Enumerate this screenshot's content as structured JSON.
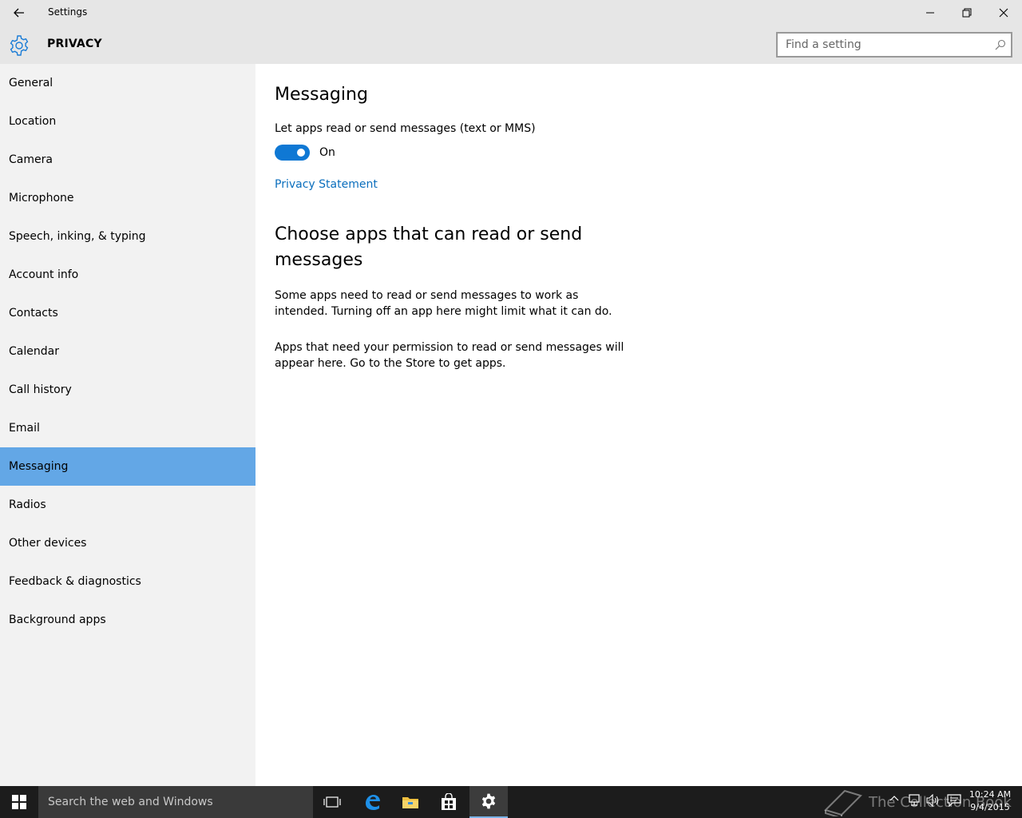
{
  "window": {
    "title": "Settings"
  },
  "header": {
    "section_title": "PRIVACY",
    "search_placeholder": "Find a setting"
  },
  "sidebar": {
    "items": [
      {
        "label": "General"
      },
      {
        "label": "Location"
      },
      {
        "label": "Camera"
      },
      {
        "label": "Microphone"
      },
      {
        "label": "Speech, inking, & typing"
      },
      {
        "label": "Account info"
      },
      {
        "label": "Contacts"
      },
      {
        "label": "Calendar"
      },
      {
        "label": "Call history"
      },
      {
        "label": "Email"
      },
      {
        "label": "Messaging"
      },
      {
        "label": "Radios"
      },
      {
        "label": "Other devices"
      },
      {
        "label": "Feedback & diagnostics"
      },
      {
        "label": "Background apps"
      }
    ],
    "selected": "Messaging"
  },
  "main": {
    "title": "Messaging",
    "setting_label": "Let apps read or send messages (text or MMS)",
    "toggle_state": "On",
    "privacy_link": "Privacy Statement",
    "section_heading": "Choose apps that can read or send messages",
    "paragraph1": "Some apps need to read or send messages to work as intended. Turning off an app here might limit what it can do.",
    "paragraph2": "Apps that need your permission to read or send messages will appear here. Go to the Store to get apps."
  },
  "taskbar": {
    "search_placeholder": "Search the web and Windows",
    "watermark": "The Collection Book",
    "time": "10:24 AM",
    "date": "9/4/2015"
  },
  "colors": {
    "accent": "#0f78d4",
    "selected_nav": "#63a7e6",
    "link": "#0a6ebd",
    "sidebar_bg": "#f2f2f2",
    "titlebar_bg": "#e6e6e6",
    "taskbar_bg": "#1c1c1c"
  }
}
